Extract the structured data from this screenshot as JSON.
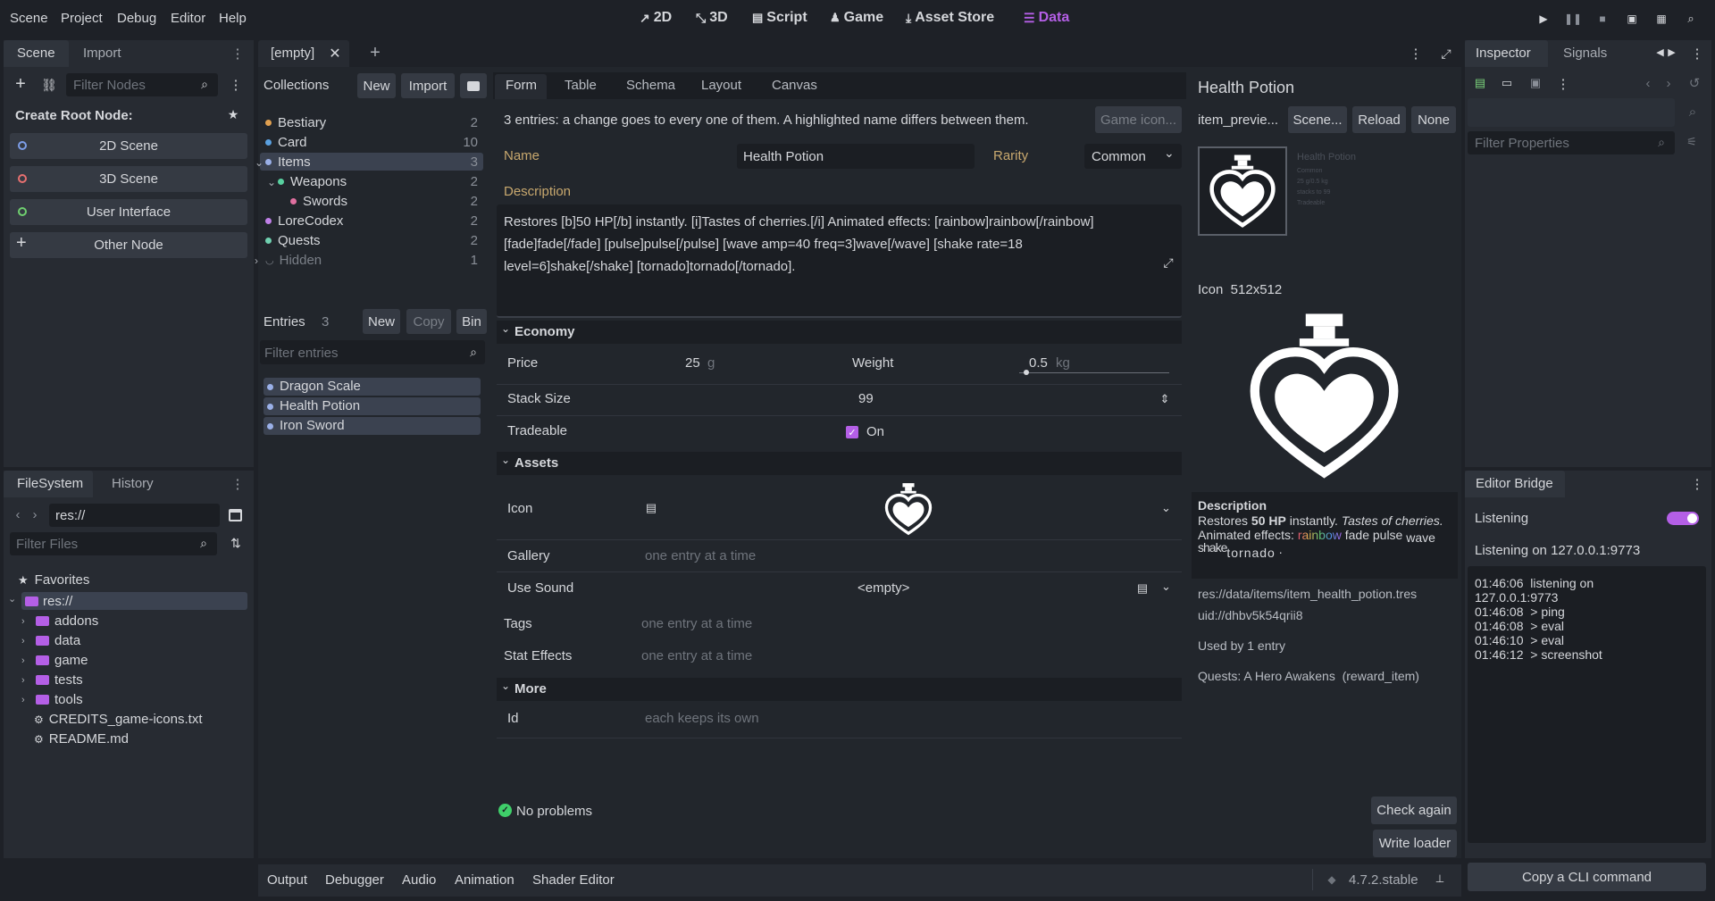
{
  "menu": {
    "items": [
      "Scene",
      "Project",
      "Debug",
      "Editor",
      "Help"
    ]
  },
  "workspaces": {
    "w2d": "2D",
    "w3d": "3D",
    "script": "Script",
    "game": "Game",
    "assetstore": "Asset Store",
    "data": "Data"
  },
  "left_dock": {
    "tabs": [
      "Scene",
      "Import"
    ],
    "filter_placeholder": "Filter Nodes",
    "create_root": "Create Root Node:",
    "nodes": [
      "2D Scene",
      "3D Scene",
      "User Interface",
      "Other Node"
    ]
  },
  "filesystem": {
    "tabs": [
      "FileSystem",
      "History"
    ],
    "path": "res://",
    "filter_placeholder": "Filter Files",
    "favorites": "Favorites",
    "root": "res://",
    "folders": [
      "addons",
      "data",
      "game",
      "tests",
      "tools"
    ],
    "files": [
      "CREDITS_game-icons.txt",
      "README.md"
    ]
  },
  "scene_tab": {
    "label": "[empty]"
  },
  "collections": {
    "title": "Collections",
    "new": "New",
    "import": "Import",
    "items": [
      {
        "label": "Bestiary",
        "count": "2",
        "color": "#e0a050"
      },
      {
        "label": "Card",
        "count": "10",
        "color": "#5aa0e0"
      },
      {
        "label": "Items",
        "count": "3",
        "color": "#9ab0e8"
      },
      {
        "label": "Weapons",
        "count": "2",
        "color": "#58d0a0"
      },
      {
        "label": "Swords",
        "count": "2",
        "color": "#e070a0"
      },
      {
        "label": "LoreCodex",
        "count": "2",
        "color": "#c080e8"
      },
      {
        "label": "Quests",
        "count": "2",
        "color": "#70d0b0"
      },
      {
        "label": "Hidden",
        "count": "1",
        "color": "#888888"
      }
    ]
  },
  "entries": {
    "title": "Entries",
    "count": "3",
    "new": "New",
    "copy": "Copy",
    "bin": "Bin",
    "filter_placeholder": "Filter entries",
    "items": [
      "Dragon Scale",
      "Health Potion",
      "Iron Sword"
    ]
  },
  "form": {
    "tabs": [
      "Form",
      "Table",
      "Schema",
      "Layout",
      "Canvas"
    ],
    "notice": "3 entries: a change goes to every one of them. A highlighted name differs between them.",
    "game_icon_btn": "Game icon...",
    "name_label": "Name",
    "name_value": "Health Potion",
    "rarity_label": "Rarity",
    "rarity_value": "Common",
    "description_label": "Description",
    "description_value": "Restores [b]50 HP[/b] instantly. [i]Tastes of cherries.[/i] Animated effects: [rainbow]rainbow[/rainbow] [fade]fade[/fade] [pulse]pulse[/pulse] [wave amp=40 freq=3]wave[/wave] [shake rate=18 level=6]shake[/shake] [tornado]tornado[/tornado].",
    "economy": "Economy",
    "price_label": "Price",
    "price_value": "25",
    "price_unit": "g",
    "weight_label": "Weight",
    "weight_value": "0.5",
    "weight_unit": "kg",
    "weight_fraction": 0.05,
    "stack_label": "Stack Size",
    "stack_value": "99",
    "tradeable_label": "Tradeable",
    "tradeable_value": "On",
    "assets": "Assets",
    "icon_label": "Icon",
    "gallery_label": "Gallery",
    "gallery_value": "one entry at a time",
    "sound_label": "Use Sound",
    "sound_value": "<empty>",
    "tags_label": "Tags",
    "tags_value": "one entry at a time",
    "stat_label": "Stat Effects",
    "stat_value": "one entry at a time",
    "more": "More",
    "id_label": "Id",
    "id_value": "each keeps its own",
    "status": "No problems",
    "check_again": "Check again",
    "write_loader": "Write loader"
  },
  "preview": {
    "title": "Health Potion",
    "res_label": "item_previe...",
    "scene_btn": "Scene...",
    "reload_btn": "Reload",
    "none_btn": "None",
    "mini_lines": [
      "Health Potion",
      "Common",
      "25 g/0.5 kg",
      "stacks to 99",
      "Tradeable"
    ],
    "icon_info": "Icon  512x512",
    "desc_title": "Description",
    "desc_restores": "Restores ",
    "desc_bold": "50 HP",
    "desc_instantly": " instantly. ",
    "desc_italic": "Tastes of cherries.",
    "desc_anim": " Animated effects: ",
    "desc_rainbow": "rainbow",
    "desc_fade": "fade",
    "desc_pulse": "pulse",
    "desc_wave": "wave",
    "desc_shake": "shake",
    "desc_tornado": "tornado",
    "desc_end": ".",
    "path": "res://data/items/item_health_potion.tres",
    "uid": "uid://dhbv5k54qrii8",
    "used_by": "Used by 1 entry",
    "quest": "Quests: A Hero Awakens  (reward_item)"
  },
  "inspector": {
    "tabs": [
      "Inspector",
      "Signals"
    ],
    "filter_placeholder": "Filter Properties"
  },
  "bridge": {
    "title": "Editor Bridge",
    "listening_label": "Listening",
    "listening_on": true,
    "listening_on_text": "Listening on 127.0.0.1:9773",
    "log": [
      "01:46:06  listening on",
      "127.0.0.1:9773",
      "01:46:08  > ping",
      "01:46:08  > eval",
      "01:46:10  > eval",
      "01:46:12  > screenshot"
    ],
    "copy_cli": "Copy a CLI command"
  },
  "bottom": {
    "tabs": [
      "Output",
      "Debugger",
      "Audio",
      "Animation",
      "Shader Editor"
    ],
    "version": "4.7.2.stable"
  },
  "colors": {
    "accent": "#b45fe6",
    "bg": "#1e2127",
    "panel": "#272b32",
    "ok": "#3fcf6a"
  }
}
